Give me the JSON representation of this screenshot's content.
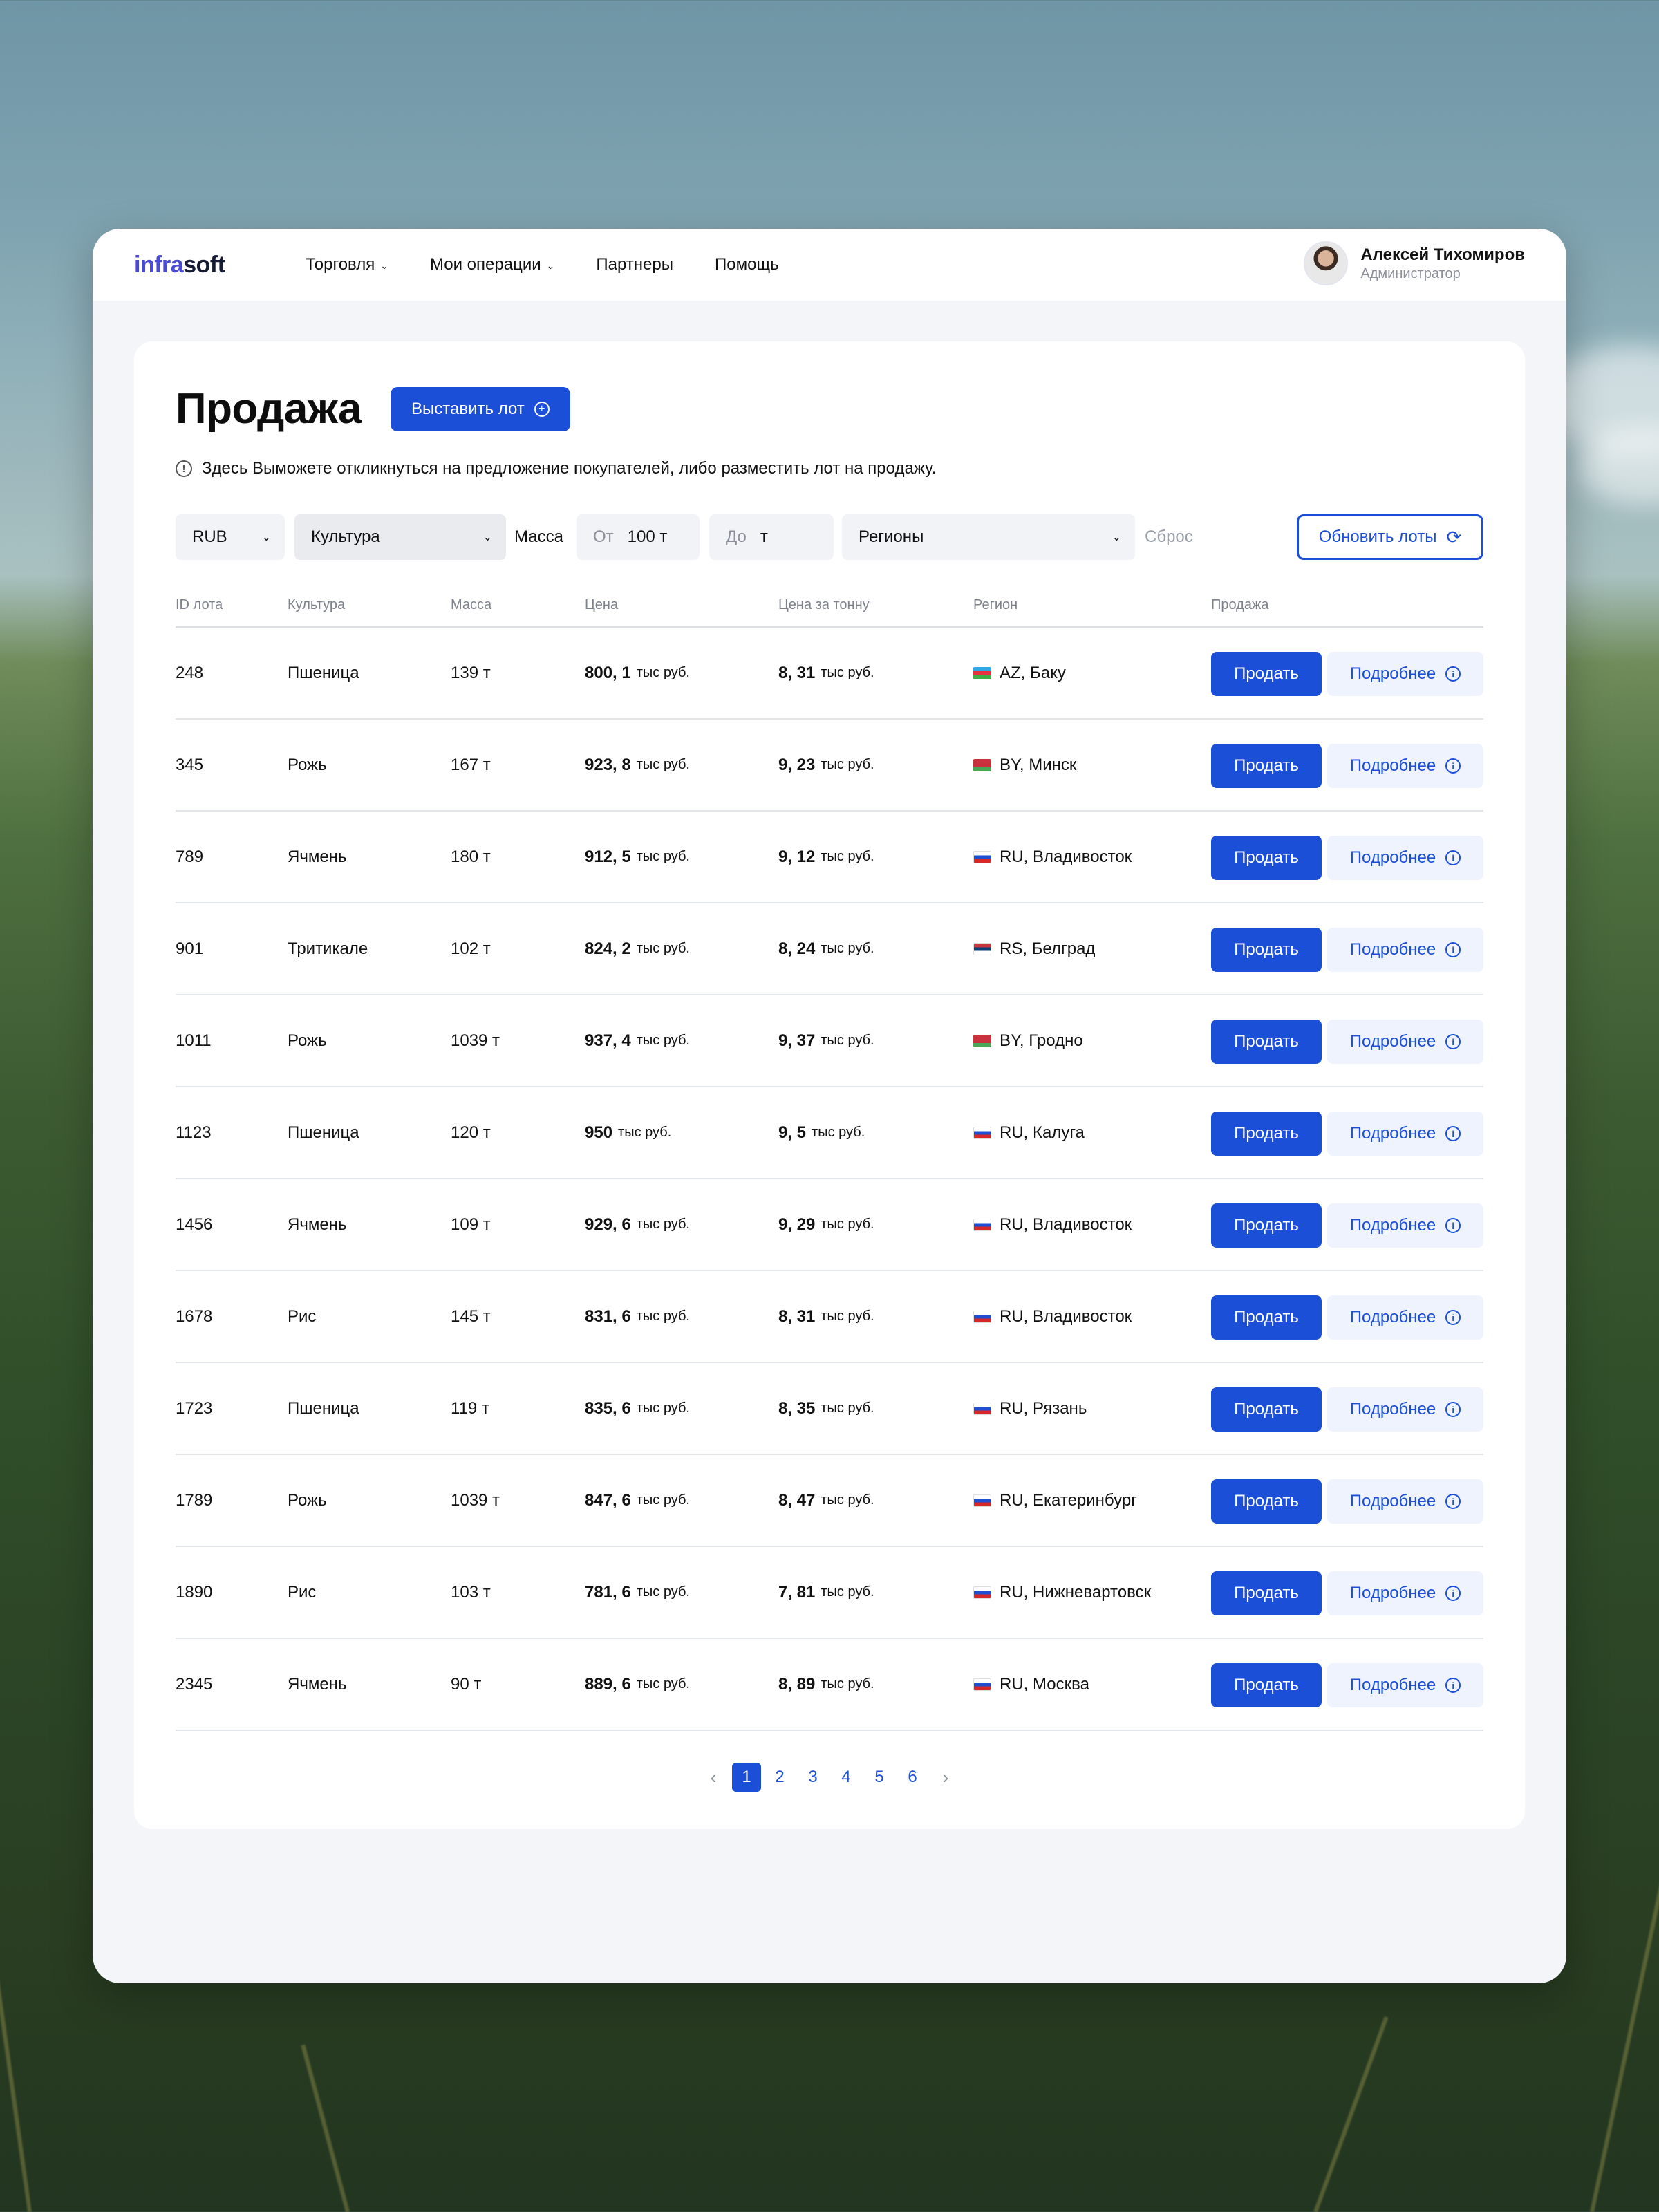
{
  "logo": {
    "part1": "infra",
    "part2": "soft"
  },
  "nav": [
    {
      "label": "Торговля",
      "dropdown": true
    },
    {
      "label": "Мои операции",
      "dropdown": true
    },
    {
      "label": "Партнеры",
      "dropdown": false
    },
    {
      "label": "Помощь",
      "dropdown": false
    }
  ],
  "user": {
    "name": "Алексей Тихомиров",
    "role": "Администратор"
  },
  "page": {
    "title": "Продажа",
    "create_button": "Выставить лот",
    "hint": "Здесь Выможете откликнуться на предложение покупателей, либо разместить лот на продажу."
  },
  "filters": {
    "currency": "RUB",
    "culture": "Культура",
    "mass_label": "Масса",
    "from_placeholder": "От",
    "from_value": "100 т",
    "to_placeholder": "До",
    "to_unit": "т",
    "regions": "Регионы",
    "reset": "Сброс",
    "refresh_button": "Обновить лоты"
  },
  "table": {
    "headers": [
      "ID лота",
      "Культура",
      "Масса",
      "Цена",
      "Цена за тонну",
      "Регион",
      "Продажа"
    ],
    "unit": "тыс руб.",
    "sell_label": "Продать",
    "more_label": "Подробнее",
    "rows": [
      {
        "id": "248",
        "culture": "Пшеница",
        "mass": "139 т",
        "price": "800, 1",
        "per_ton": "8, 31",
        "flag": "az",
        "region": "AZ, Баку"
      },
      {
        "id": "345",
        "culture": "Рожь",
        "mass": "167 т",
        "price": "923, 8",
        "per_ton": "9, 23",
        "flag": "by",
        "region": "BY, Минск"
      },
      {
        "id": "789",
        "culture": "Ячмень",
        "mass": "180 т",
        "price": "912, 5",
        "per_ton": "9, 12",
        "flag": "ru",
        "region": "RU, Владивосток"
      },
      {
        "id": "901",
        "culture": "Тритикале",
        "mass": "102 т",
        "price": "824, 2",
        "per_ton": "8, 24",
        "flag": "rs",
        "region": "RS, Белград"
      },
      {
        "id": "1011",
        "culture": "Рожь",
        "mass": "1039 т",
        "price": "937, 4",
        "per_ton": "9, 37",
        "flag": "by",
        "region": "BY, Гродно"
      },
      {
        "id": "1123",
        "culture": "Пшеница",
        "mass": "120 т",
        "price": "950",
        "per_ton": "9, 5",
        "flag": "ru",
        "region": "RU, Калуга"
      },
      {
        "id": "1456",
        "culture": "Ячмень",
        "mass": "109 т",
        "price": "929, 6",
        "per_ton": "9, 29",
        "flag": "ru",
        "region": "RU, Владивосток"
      },
      {
        "id": "1678",
        "culture": "Рис",
        "mass": "145 т",
        "price": "831, 6",
        "per_ton": "8, 31",
        "flag": "ru",
        "region": "RU, Владивосток"
      },
      {
        "id": "1723",
        "culture": "Пшеница",
        "mass": "119 т",
        "price": "835, 6",
        "per_ton": "8, 35",
        "flag": "ru",
        "region": "RU, Рязань"
      },
      {
        "id": "1789",
        "culture": "Рожь",
        "mass": "1039 т",
        "price": "847, 6",
        "per_ton": "8, 47",
        "flag": "ru",
        "region": "RU, Екатеринбург"
      },
      {
        "id": "1890",
        "culture": "Рис",
        "mass": "103 т",
        "price": "781, 6",
        "per_ton": "7, 81",
        "flag": "ru",
        "region": "RU, Нижневартовск"
      },
      {
        "id": "2345",
        "culture": "Ячмень",
        "mass": "90 т",
        "price": "889, 6",
        "per_ton": "8, 89",
        "flag": "ru",
        "region": "RU, Москва"
      }
    ]
  },
  "pagination": {
    "pages": [
      "1",
      "2",
      "3",
      "4",
      "5",
      "6"
    ],
    "current": "1"
  },
  "colors": {
    "accent": "#1c4fd8",
    "logo_accent": "#4a4ad8",
    "background_card": "#ffffff",
    "background_app": "#f3f5f9"
  }
}
